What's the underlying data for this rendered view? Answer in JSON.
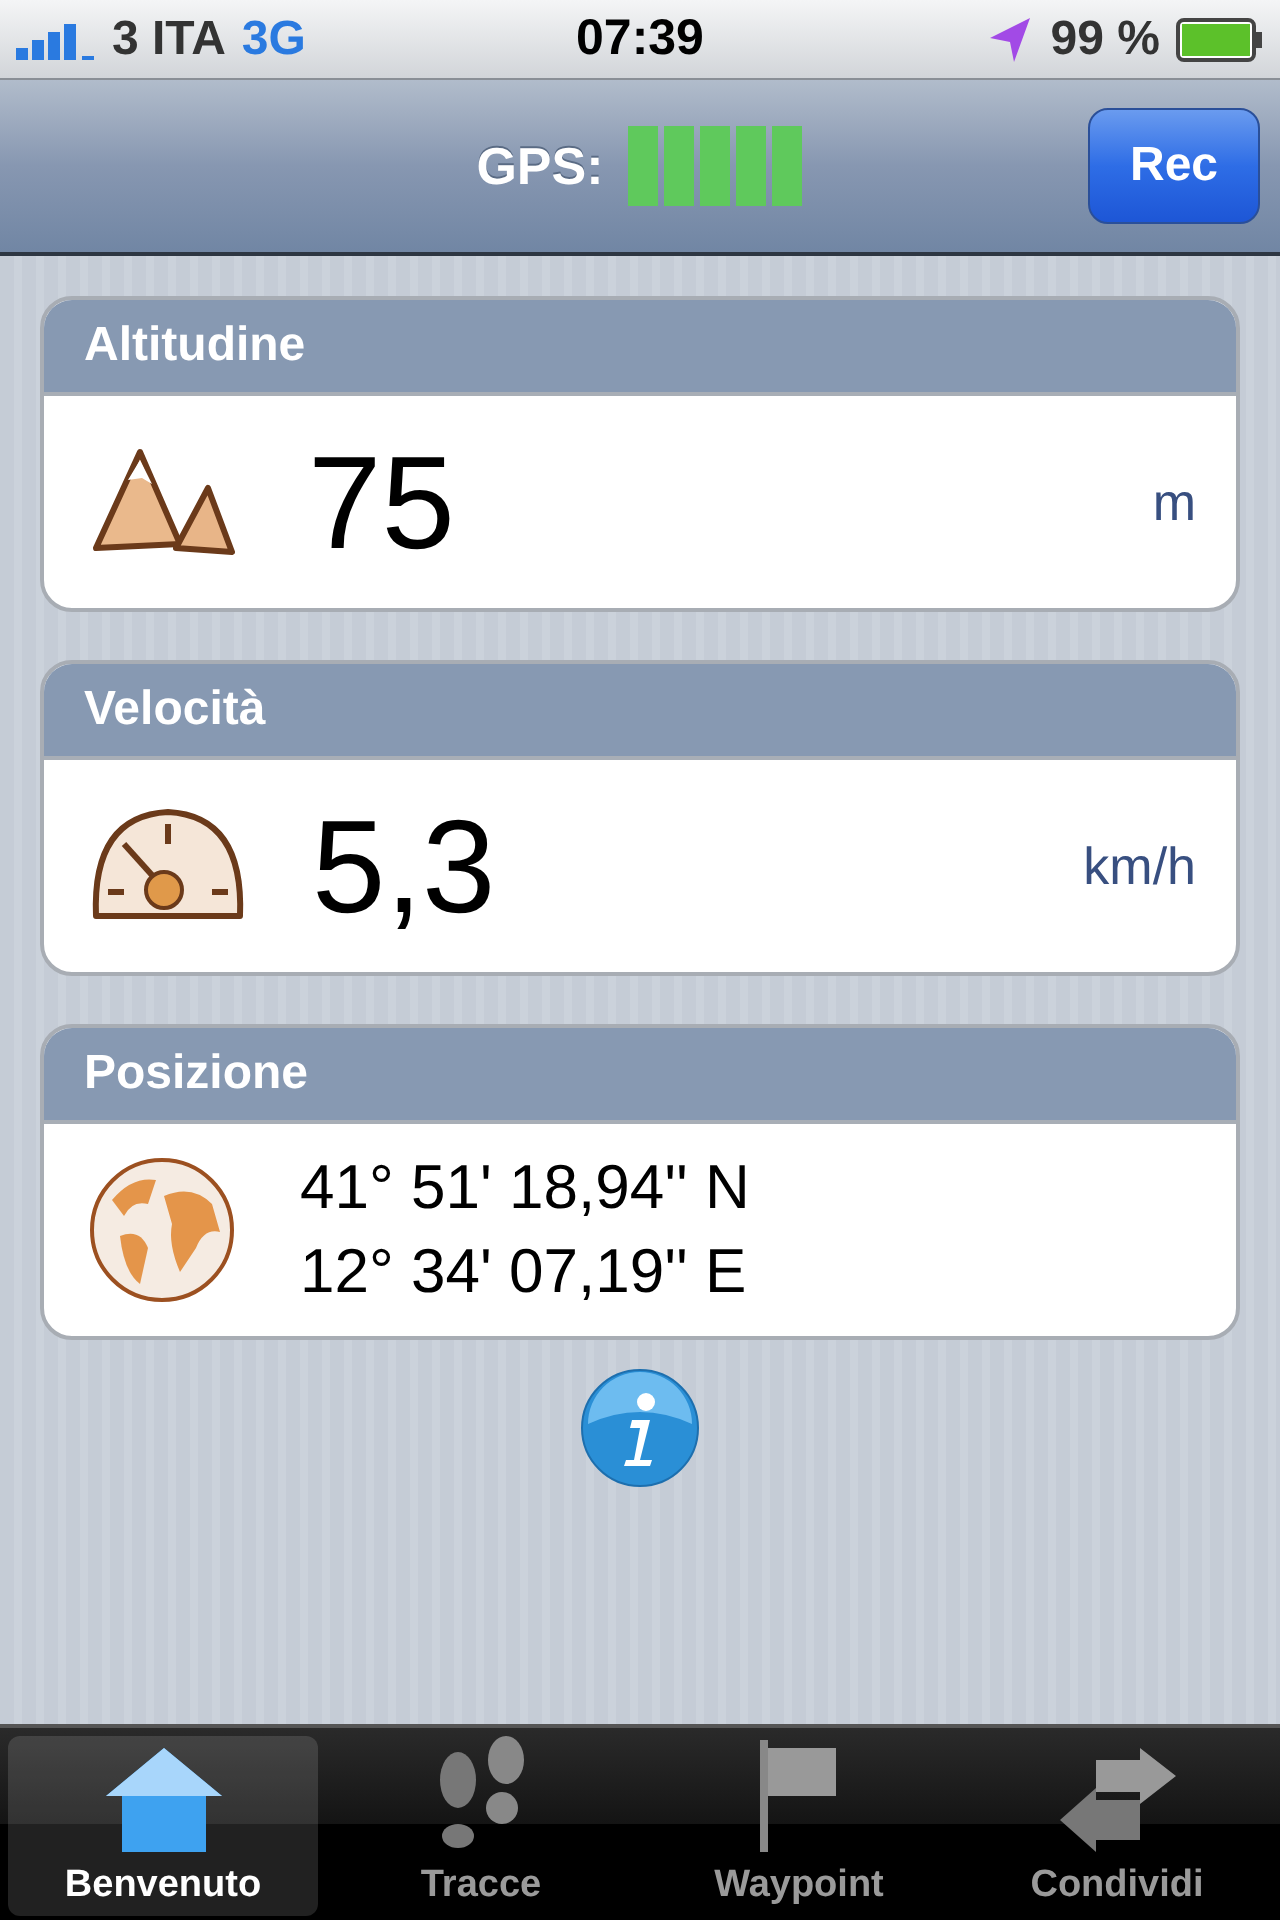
{
  "status_bar": {
    "carrier": "3 ITA",
    "network": "3G",
    "time": "07:39",
    "battery": "99 %"
  },
  "nav_bar": {
    "gps_label": "GPS:",
    "rec_button": "Rec"
  },
  "cards": [
    {
      "kind": "altitude",
      "title": "Altitudine",
      "value": "75",
      "unit": "m"
    },
    {
      "kind": "speed",
      "title": "Velocità",
      "value": "5,3",
      "unit": "km/h"
    },
    {
      "kind": "position",
      "title": "Posizione",
      "lines": [
        "41° 51' 18,94'' N",
        "12° 34' 07,19'' E"
      ]
    }
  ],
  "tabs": [
    {
      "label": "Benvenuto",
      "selected": true
    },
    {
      "label": "Tracce",
      "selected": false
    },
    {
      "label": "Waypoint",
      "selected": false
    },
    {
      "label": "Condividi",
      "selected": false
    }
  ]
}
